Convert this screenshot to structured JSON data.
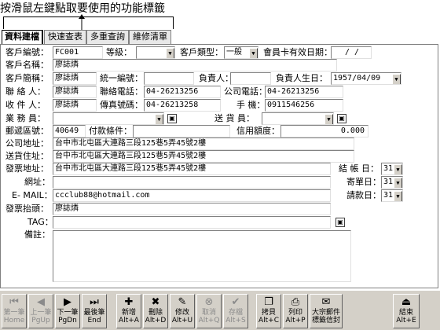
{
  "tip": "按滑鼠左鍵點取要使用的功能標籤",
  "tabs": [
    "資料建檔",
    "快速查表",
    "多重查詢",
    "維修清單"
  ],
  "form": {
    "customer_id_label": "客戶編號：",
    "customer_id": "FC001",
    "grade_label": "等級：",
    "grade": "",
    "customer_type_label": "客戶類型：",
    "customer_type": "一般",
    "member_expiry_label": "會員卡有效日期：",
    "member_expiry": "/ /",
    "customer_name_label": "客戶名稱：",
    "customer_name": "廖誌燐",
    "short_name_label": "客戶簡稱：",
    "short_name": "廖誌燐",
    "tax_id_label": "統一編號：",
    "tax_id": "",
    "owner_label": "負責人：",
    "owner": "",
    "owner_birthday_label": "負責人生日：",
    "owner_birthday": "1957/04/09",
    "contact_label": "聯 絡 人：",
    "contact": "廖誌燐",
    "contact_phone_label": "聯絡電話：",
    "contact_phone": "04-26213256",
    "company_phone_label": "公司電話：",
    "company_phone": "04-26213256",
    "receiver_label": "收 件 人：",
    "receiver": "廖誌燐",
    "fax_label": "傳真號碼：",
    "fax": "04-26213258",
    "mobile_label": "手 機：",
    "mobile": "0911546256",
    "sales_label": "業 務 員：",
    "sales": "",
    "delivery_label": "送 貨 員：",
    "delivery": "",
    "zip_label": "郵遞區號：",
    "zip": "40649",
    "payment_terms_label": "付款條件：",
    "payment_terms": "",
    "credit_label": "信用額度：",
    "credit": "0.000",
    "company_addr_label": "公司地址：",
    "company_addr": "台中市北屯區大連路三段125巷5弄45號2樓",
    "delivery_addr_label": "送貨住址：",
    "delivery_addr": "台中市北屯區大連路三段125巷5弄45號2樓",
    "invoice_addr_label": "發票地址：",
    "invoice_addr": "台中市北屯區大連路三段125巷5弄45號2樓",
    "closing_day_label": "結 帳 日：",
    "closing_day": "31",
    "website_label": "網址：",
    "website": "",
    "billing_day_label": "寄單日：",
    "billing_day": "31",
    "email_label": "E- MAIL：",
    "email": "ccclub88@hotmail.com",
    "payment_day_label": "請款日：",
    "payment_day": "31",
    "invoice_title_label": "發票抬頭：",
    "invoice_title": "廖誌燐",
    "tag_label": "TAG：",
    "tag": "",
    "remarks_label": "備註：",
    "remarks": ""
  },
  "toolbar": [
    {
      "label": "第一筆",
      "key": "Home",
      "icon": "first-record-icon",
      "glyph": "⏮",
      "enabled": false
    },
    {
      "label": "上一筆",
      "key": "PgUp",
      "icon": "prev-record-icon",
      "glyph": "◀",
      "enabled": false
    },
    {
      "label": "下一筆",
      "key": "PgDn",
      "icon": "next-record-icon",
      "glyph": "▶",
      "enabled": true
    },
    {
      "label": "最後筆",
      "key": "End",
      "icon": "last-record-icon",
      "glyph": "⏭",
      "enabled": true
    },
    {
      "label": "新增",
      "key": "Alt+A",
      "icon": "add-icon",
      "glyph": "✚",
      "enabled": true
    },
    {
      "label": "刪除",
      "key": "Alt+D",
      "icon": "delete-icon",
      "glyph": "✖",
      "enabled": true
    },
    {
      "label": "修改",
      "key": "Alt+U",
      "icon": "edit-icon",
      "glyph": "✎",
      "enabled": true
    },
    {
      "label": "取消",
      "key": "Alt+Q",
      "icon": "cancel-icon",
      "glyph": "⊗",
      "enabled": false
    },
    {
      "label": "存檔",
      "key": "Alt+S",
      "icon": "save-icon",
      "glyph": "✔",
      "enabled": false
    },
    {
      "label": "拷貝",
      "key": "Alt+C",
      "icon": "copy-icon",
      "glyph": "❐",
      "enabled": true
    },
    {
      "label": "列印",
      "key": "Alt+P",
      "icon": "print-icon",
      "glyph": "⎙",
      "enabled": true
    },
    {
      "label": "大宗郵件",
      "key": "標籤信封",
      "icon": "bulk-mail-icon",
      "glyph": "✉",
      "enabled": true
    },
    {
      "label": "結束",
      "key": "Alt+E",
      "icon": "exit-icon",
      "glyph": "⏏",
      "enabled": true
    }
  ]
}
